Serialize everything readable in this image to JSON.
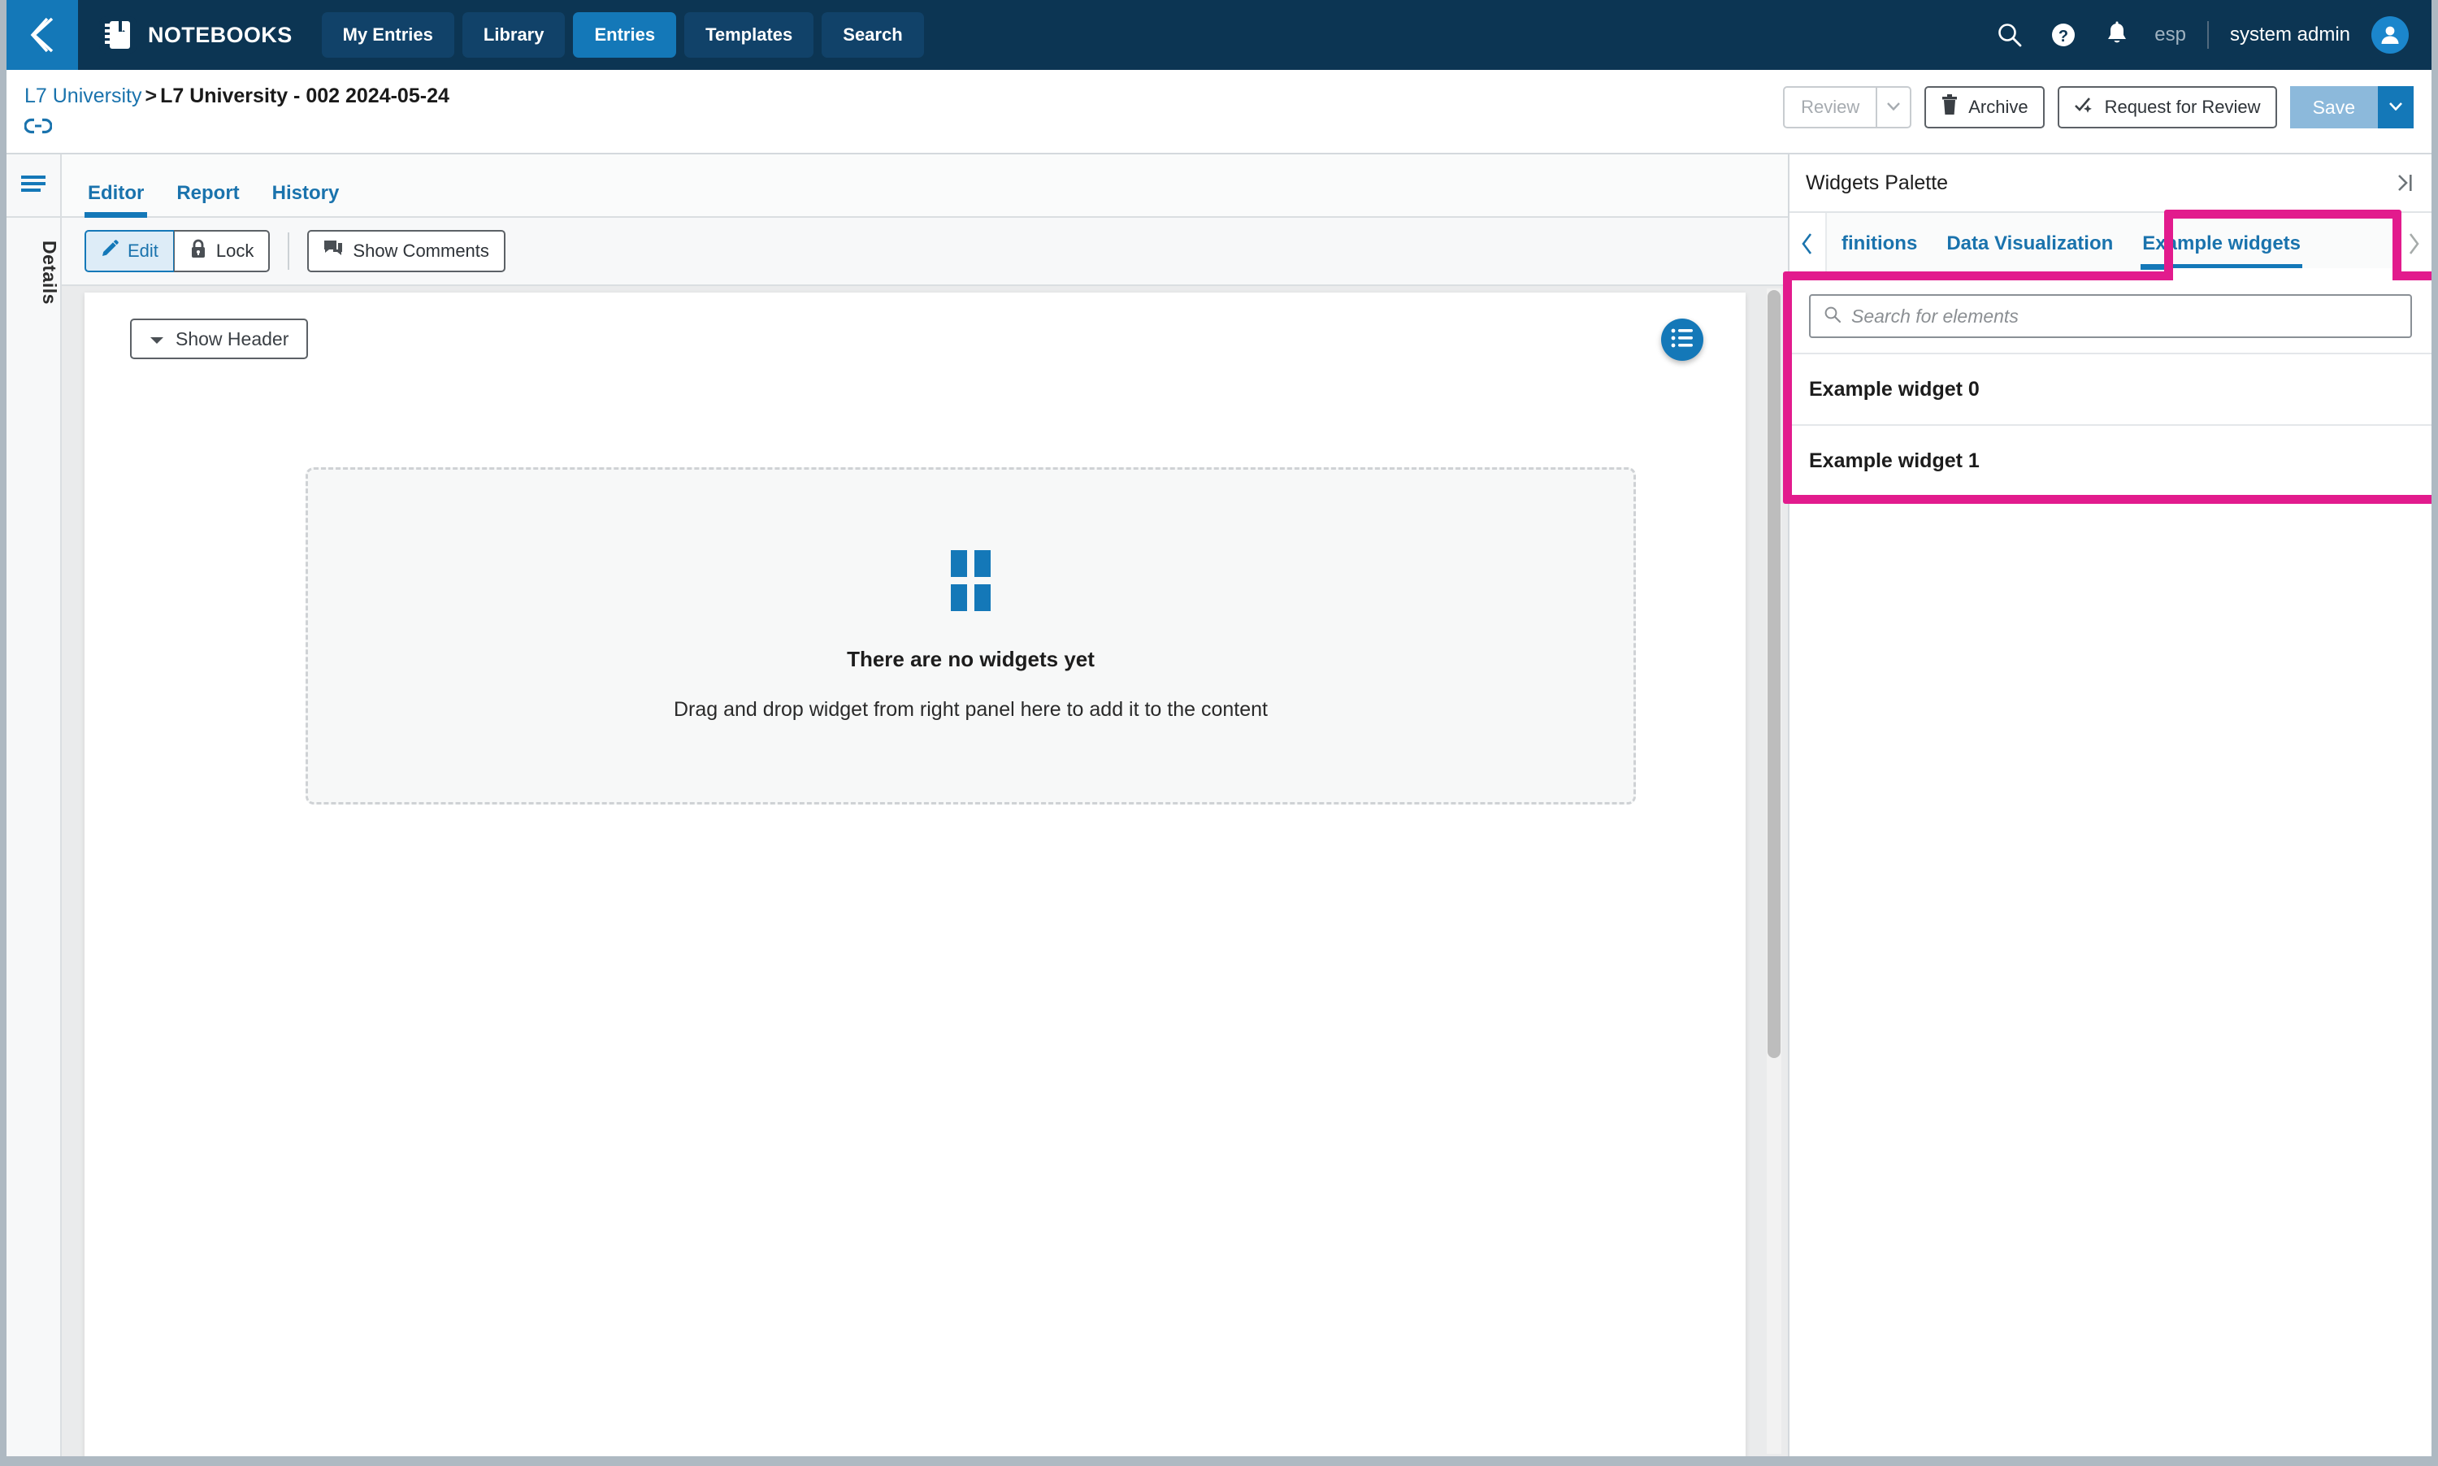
{
  "topnav": {
    "back_icon": "chevron-left-icon",
    "brand": "NOTEBOOKS",
    "brand_icon": "notebook-icon",
    "tabs": [
      {
        "label": "My Entries",
        "active": false
      },
      {
        "label": "Library",
        "active": false
      },
      {
        "label": "Entries",
        "active": true
      },
      {
        "label": "Templates",
        "active": false
      },
      {
        "label": "Search",
        "active": false
      }
    ],
    "search_icon": "search-icon",
    "help_icon": "help-circle-icon",
    "notifications_icon": "bell-icon",
    "language": "esp",
    "divider": "|",
    "username": "system admin",
    "avatar_icon": "user-avatar-icon"
  },
  "breadcrumb": {
    "parent": "L7 University",
    "separator": ">",
    "current": "L7 University - 002 2024-05-24",
    "link_icon": "link-icon"
  },
  "actions": {
    "review_label": "Review",
    "review_caret": "chevron-down-icon",
    "archive_label": "Archive",
    "archive_icon": "trash-icon",
    "request_label": "Request for Review",
    "request_icon": "magic-wand-icon",
    "save_label": "Save",
    "save_caret": "chevron-down-icon"
  },
  "rail": {
    "menu_icon": "hamburger-menu-icon",
    "label": "Details"
  },
  "editor_tabs": [
    {
      "label": "Editor",
      "active": true
    },
    {
      "label": "Report",
      "active": false
    },
    {
      "label": "History",
      "active": false
    }
  ],
  "toolbar": {
    "edit_label": "Edit",
    "edit_icon": "pencil-icon",
    "lock_label": "Lock",
    "lock_icon": "lock-icon",
    "comments_label": "Show Comments",
    "comments_icon": "comment-icon"
  },
  "canvas": {
    "show_header_label": "Show Header",
    "show_header_caret": "caret-down-icon",
    "fab_icon": "list-icon",
    "empty_icon": "widgets-grid-icon",
    "empty_title": "There are no widgets yet",
    "empty_subtitle": "Drag and drop widget from right panel here to add it to the content"
  },
  "right_panel": {
    "title": "Widgets Palette",
    "collapse_icon": "collapse-panel-icon",
    "prev_icon": "chevron-left-icon",
    "next_icon": "chevron-right-icon",
    "tabs": [
      {
        "label": "finitions",
        "active": false
      },
      {
        "label": "Data Visualization",
        "active": false
      },
      {
        "label": "Example widgets",
        "active": true
      }
    ],
    "search": {
      "placeholder": "Search for elements",
      "value": "",
      "icon": "search-icon"
    },
    "widgets": [
      {
        "label": "Example widget 0"
      },
      {
        "label": "Example widget 1"
      }
    ]
  },
  "colors": {
    "nav_bg": "#0c3553",
    "accent_blue": "#1478b8",
    "link_blue": "#1a73ad",
    "highlight_magenta": "#e21b8d",
    "save_disabled": "#8cb9db"
  }
}
